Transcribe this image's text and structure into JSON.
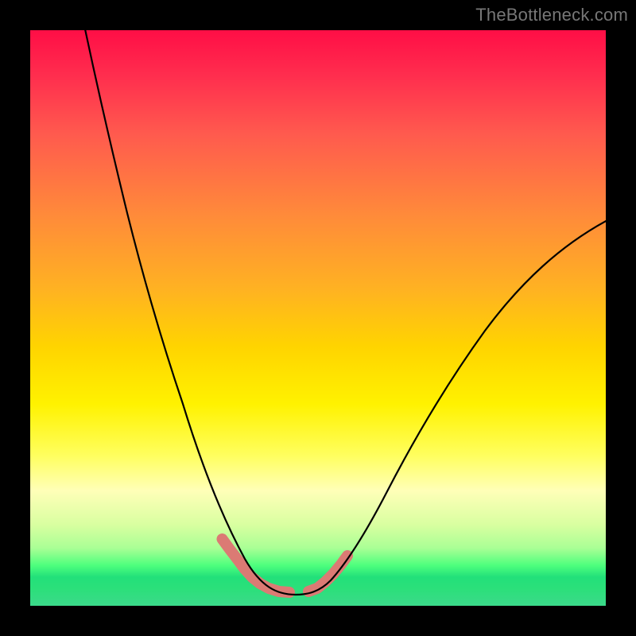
{
  "watermark": "TheBottleneck.com",
  "chart_data": {
    "type": "line",
    "title": "",
    "xlabel": "",
    "ylabel": "",
    "xlim": [
      0,
      100
    ],
    "ylim": [
      0,
      100
    ],
    "legend": false,
    "grid": false,
    "background": "vertical heat gradient (red → yellow → green)",
    "series": [
      {
        "name": "left-branch",
        "x": [
          10,
          15,
          20,
          25,
          30,
          33,
          36,
          38,
          40
        ],
        "values": [
          100,
          70,
          44,
          25,
          13,
          8,
          5,
          3.5,
          2.5
        ]
      },
      {
        "name": "valley-floor",
        "x": [
          40,
          42,
          45,
          48,
          50
        ],
        "values": [
          2.5,
          2,
          2,
          2,
          2.3
        ]
      },
      {
        "name": "right-branch",
        "x": [
          50,
          55,
          60,
          65,
          70,
          80,
          90,
          100
        ],
        "values": [
          2.3,
          6,
          12,
          20,
          28,
          44,
          57,
          67
        ]
      }
    ],
    "highlight_segments": [
      {
        "name": "left-highlight",
        "x": [
          34,
          36,
          38,
          40,
          42,
          44
        ],
        "values": [
          12,
          8,
          5.2,
          3.5,
          2.8,
          2.4
        ]
      },
      {
        "name": "right-highlight",
        "x": [
          48,
          50,
          52,
          54
        ],
        "values": [
          2.5,
          3.5,
          5.2,
          7.5
        ]
      }
    ],
    "annotation": "minimum around x≈45, y≈2"
  }
}
